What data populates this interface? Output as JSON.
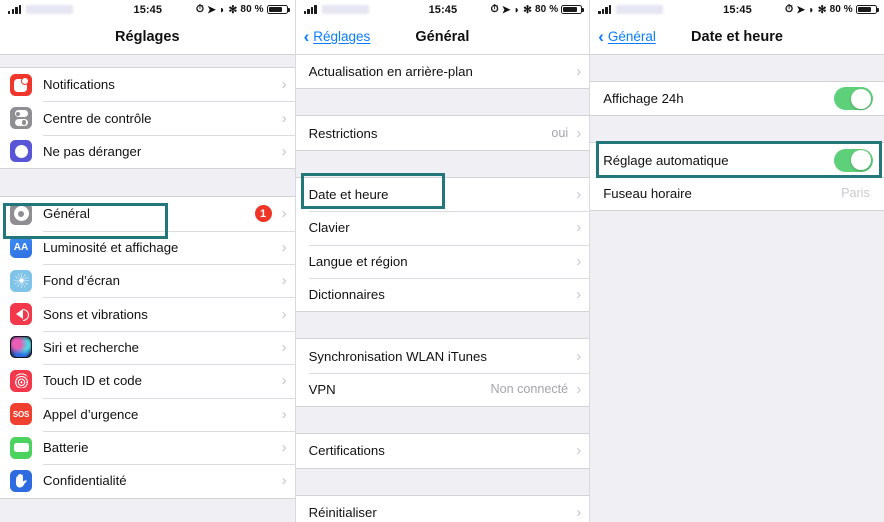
{
  "status_bar": {
    "time": "15:45",
    "battery_percent": "80 %",
    "icons": [
      "signal-bars",
      "carrier-redacted",
      "alarm-icon",
      "location-arrow-icon",
      "do-not-disturb-icon",
      "bluetooth-icon",
      "battery-icon"
    ],
    "alarm_glyph": "⏱",
    "location_glyph": "➤",
    "dnd_glyph": "◗",
    "bluetooth_glyph": "✻"
  },
  "colors": {
    "highlight": "#23777a",
    "toggle_on": "#5ed07a",
    "badge": "#f03526",
    "link": "#0a7cff",
    "group_bg": "#efeff4"
  },
  "panels": [
    {
      "id": "reglages",
      "nav": {
        "title": "Réglages",
        "back_label": null,
        "chevron": "‹"
      },
      "groups": [
        {
          "rows": [
            {
              "label": "Notifications",
              "icon": "notifications-icon",
              "icon_class": "ic-notif",
              "chevron": "›"
            },
            {
              "label": "Centre de contrôle",
              "icon": "control-center-icon",
              "icon_class": "ic-cc",
              "chevron": "›"
            },
            {
              "label": "Ne pas déranger",
              "icon": "do-not-disturb-icon",
              "icon_class": "ic-dnd",
              "chevron": "›"
            }
          ]
        },
        {
          "rows": [
            {
              "label": "Général",
              "icon": "gear-icon",
              "icon_class": "ic-gen",
              "badge": "1",
              "chevron": "›",
              "highlighted": true
            },
            {
              "label": "Luminosité et affichage",
              "icon": "brightness-icon",
              "icon_class": "ic-aa",
              "icon_text": "AA",
              "chevron": "›"
            },
            {
              "label": "Fond d’écran",
              "icon": "wallpaper-icon",
              "icon_class": "ic-wall",
              "chevron": "›"
            },
            {
              "label": "Sons et vibrations",
              "icon": "sound-icon",
              "icon_class": "ic-snd",
              "chevron": "›"
            },
            {
              "label": "Siri et recherche",
              "icon": "siri-icon",
              "icon_class": "ic-siri",
              "chevron": "›"
            },
            {
              "label": "Touch ID et code",
              "icon": "touch-id-icon",
              "icon_class": "ic-touch",
              "chevron": "›"
            },
            {
              "label": "Appel d’urgence",
              "icon": "sos-icon",
              "icon_class": "ic-sos",
              "icon_text": "SOS",
              "chevron": "›"
            },
            {
              "label": "Batterie",
              "icon": "battery-icon",
              "icon_class": "ic-batt",
              "chevron": "›"
            },
            {
              "label": "Confidentialité",
              "icon": "privacy-hand-icon",
              "icon_class": "ic-priv",
              "chevron": "›"
            }
          ]
        }
      ]
    },
    {
      "id": "general",
      "nav": {
        "title": "Général",
        "back_label": "Réglages",
        "chevron": "‹"
      },
      "groups": [
        {
          "rows": [
            {
              "label": "Actualisation en arrière-plan",
              "chevron": "›"
            }
          ]
        },
        {
          "rows": [
            {
              "label": "Restrictions",
              "value": "oui",
              "chevron": "›"
            }
          ]
        },
        {
          "rows": [
            {
              "label": "Date et heure",
              "chevron": "›",
              "highlighted": true
            },
            {
              "label": "Clavier",
              "chevron": "›"
            },
            {
              "label": "Langue et région",
              "chevron": "›"
            },
            {
              "label": "Dictionnaires",
              "chevron": "›"
            }
          ]
        },
        {
          "rows": [
            {
              "label": "Synchronisation WLAN iTunes",
              "chevron": "›"
            },
            {
              "label": "VPN",
              "value": "Non connecté",
              "chevron": "›"
            }
          ]
        },
        {
          "rows": [
            {
              "label": "Certifications",
              "chevron": "›"
            }
          ]
        },
        {
          "rows": [
            {
              "label": "Réinitialiser",
              "chevron": "›"
            }
          ]
        }
      ]
    },
    {
      "id": "date-et-heure",
      "nav": {
        "title": "Date et heure",
        "back_label": "Général",
        "chevron": "‹"
      },
      "groups": [
        {
          "rows": [
            {
              "label": "Affichage 24h",
              "toggle": true,
              "toggle_on": true
            }
          ]
        },
        {
          "rows": [
            {
              "label": "Réglage automatique",
              "toggle": true,
              "toggle_on": true,
              "highlighted": true
            },
            {
              "label": "Fuseau horaire",
              "value": "Paris",
              "value_faint": true
            }
          ]
        }
      ]
    }
  ]
}
